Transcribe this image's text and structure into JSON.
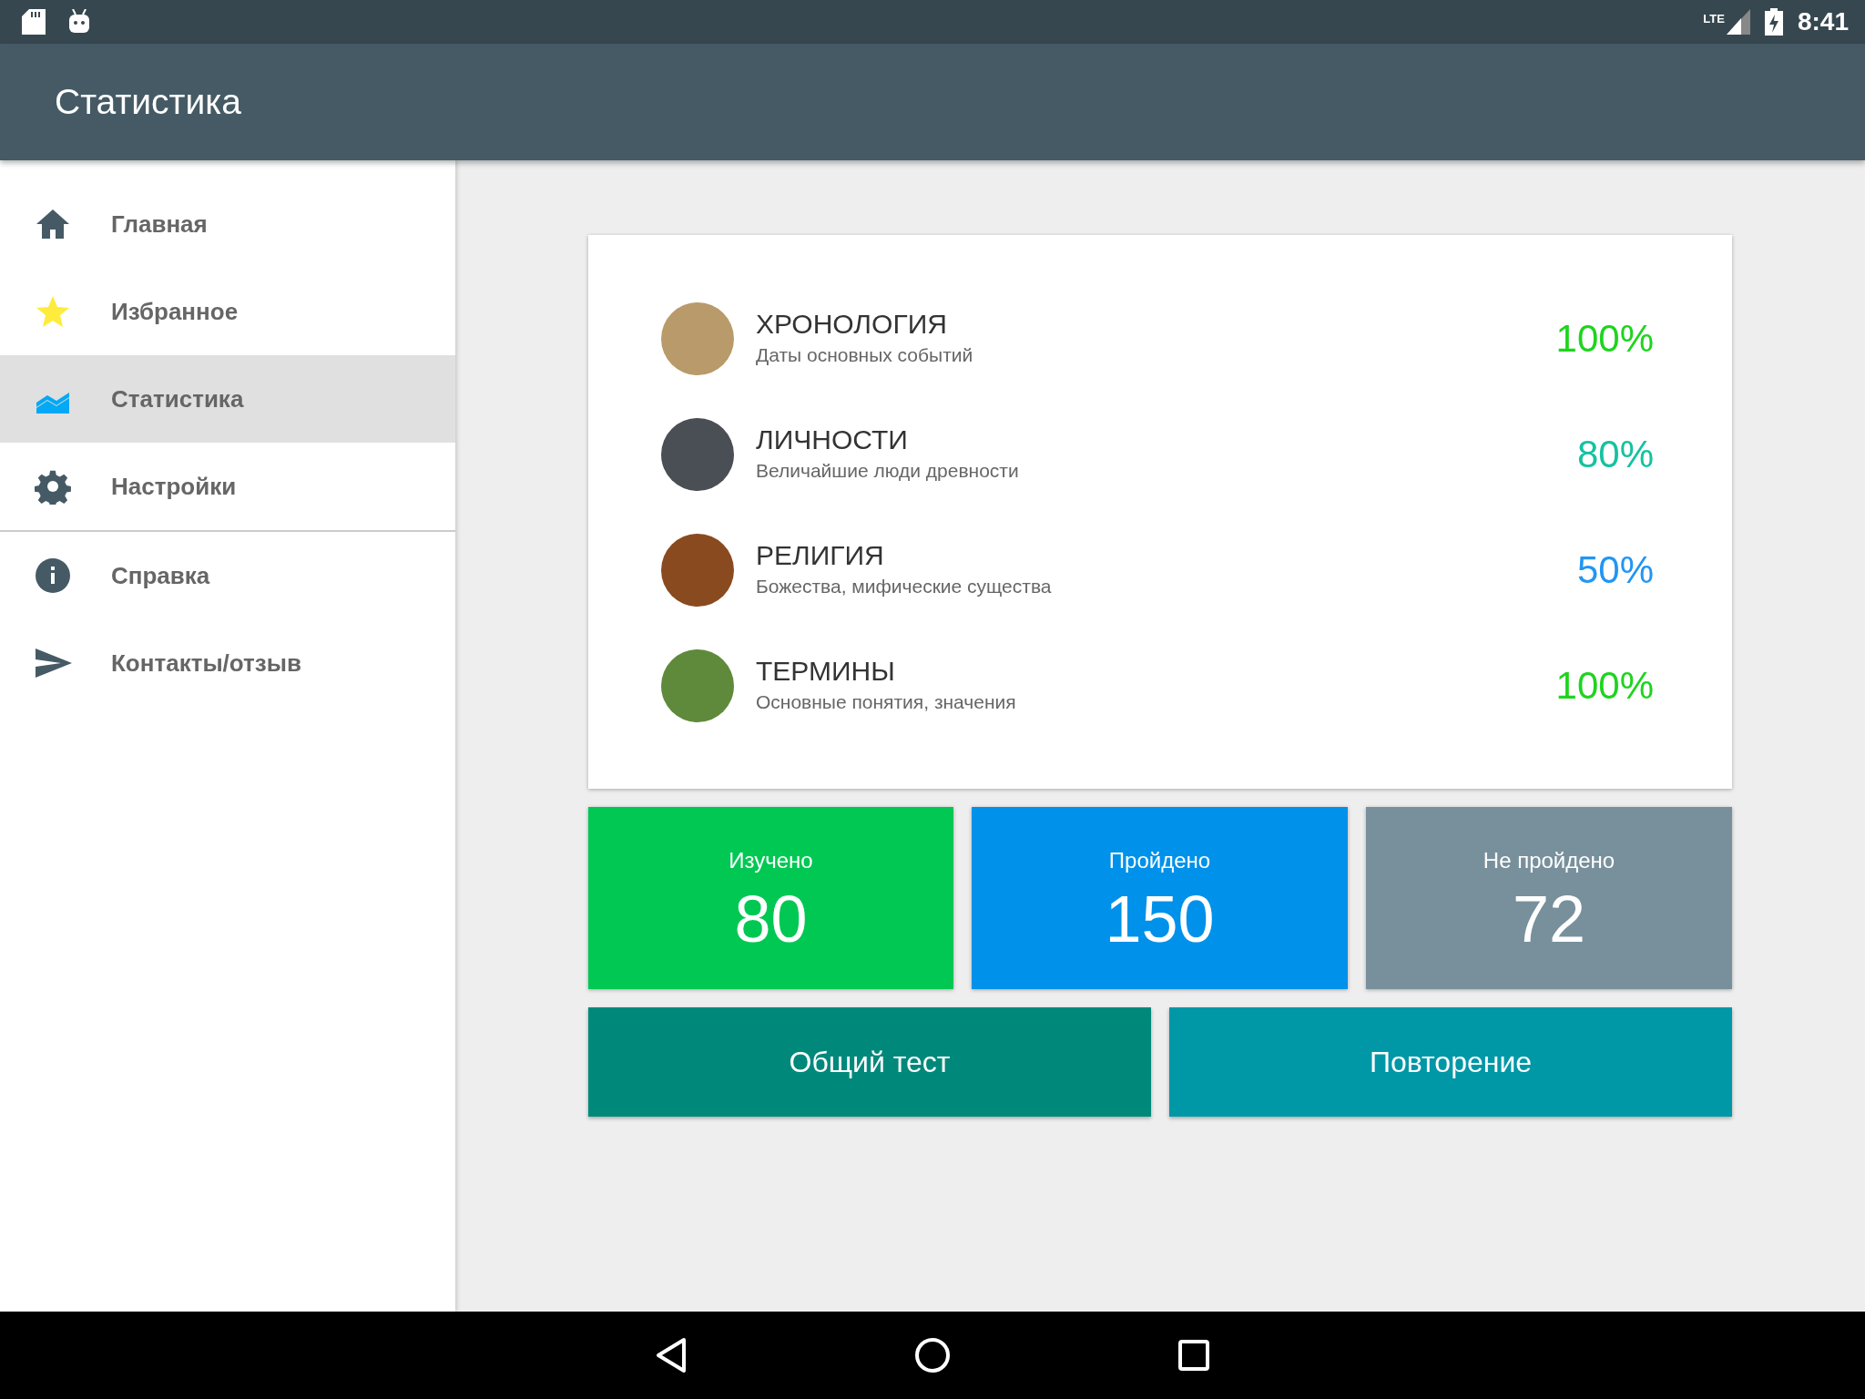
{
  "status_bar": {
    "time": "8:41",
    "network": "LTE"
  },
  "app_bar": {
    "title": "Статистика"
  },
  "sidebar": {
    "groups": [
      [
        {
          "label": "Главная",
          "selected": false
        },
        {
          "label": "Избранное",
          "selected": false
        },
        {
          "label": "Статистика",
          "selected": true
        },
        {
          "label": "Настройки",
          "selected": false
        }
      ],
      [
        {
          "label": "Справка",
          "selected": false
        },
        {
          "label": "Контакты/отзыв",
          "selected": false
        }
      ]
    ]
  },
  "categories": [
    {
      "title": "ХРОНОЛОГИЯ",
      "subtitle": "Даты основных событий",
      "percent": "100%",
      "color": "#1ed41e"
    },
    {
      "title": "ЛИЧНОСТИ",
      "subtitle": "Величайшие люди древности",
      "percent": "80%",
      "color": "#14c2a0"
    },
    {
      "title": "РЕЛИГИЯ",
      "subtitle": "Божества, мифические существа",
      "percent": "50%",
      "color": "#2196f3"
    },
    {
      "title": "ТЕРМИНЫ",
      "subtitle": "Основные понятия, значения",
      "percent": "100%",
      "color": "#1ed41e"
    }
  ],
  "stats": [
    {
      "label": "Изучено",
      "value": "80",
      "color": "#00c853"
    },
    {
      "label": "Пройдено",
      "value": "150",
      "color": "#0091ea"
    },
    {
      "label": "Не пройдено",
      "value": "72",
      "color": "#78909c"
    }
  ],
  "buttons": [
    {
      "label": "Общий тест",
      "color": "#00897b"
    },
    {
      "label": "Повторение",
      "color": "#0097a7"
    }
  ]
}
